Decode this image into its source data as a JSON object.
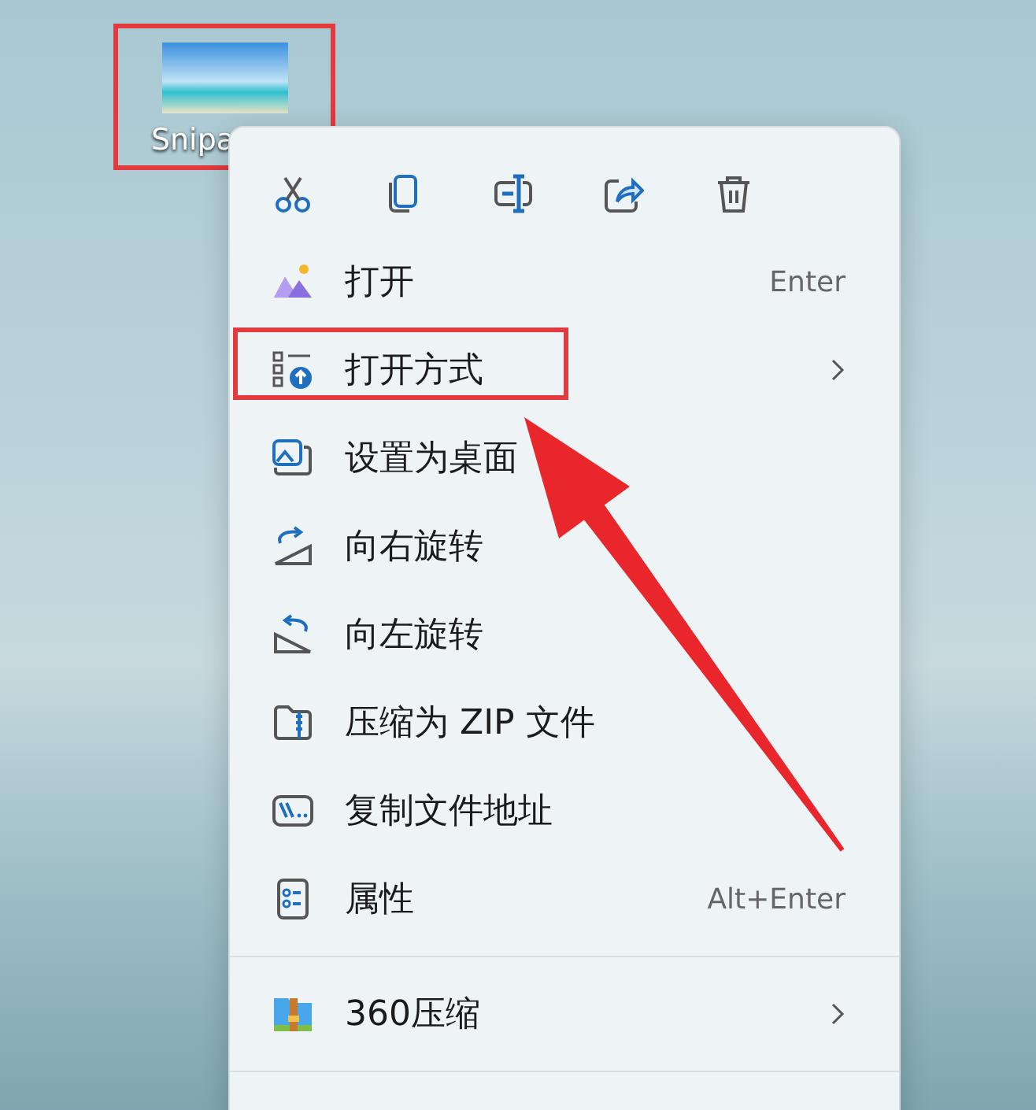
{
  "desktop_icon": {
    "label": "Snipa",
    "highlighted": true
  },
  "context_menu": {
    "groups": [
      {
        "items": [
          {
            "label": "打开",
            "shortcut": "Enter",
            "submenu": false,
            "highlighted": false
          },
          {
            "label": "打开方式",
            "submenu": true,
            "highlighted": true
          },
          {
            "label": "设置为桌面",
            "submenu": false,
            "highlighted": false
          },
          {
            "label": "向右旋转",
            "submenu": false,
            "highlighted": false
          },
          {
            "label": "向左旋转",
            "submenu": false,
            "highlighted": false
          },
          {
            "label": "压缩为 ZIP 文件",
            "submenu": false,
            "highlighted": false
          },
          {
            "label": "复制文件地址",
            "submenu": false,
            "highlighted": false
          },
          {
            "label": "属性",
            "shortcut": "Alt+Enter",
            "submenu": false,
            "highlighted": false
          }
        ]
      },
      {
        "items": [
          {
            "label": "360压缩",
            "submenu": true,
            "highlighted": false
          }
        ]
      }
    ]
  }
}
